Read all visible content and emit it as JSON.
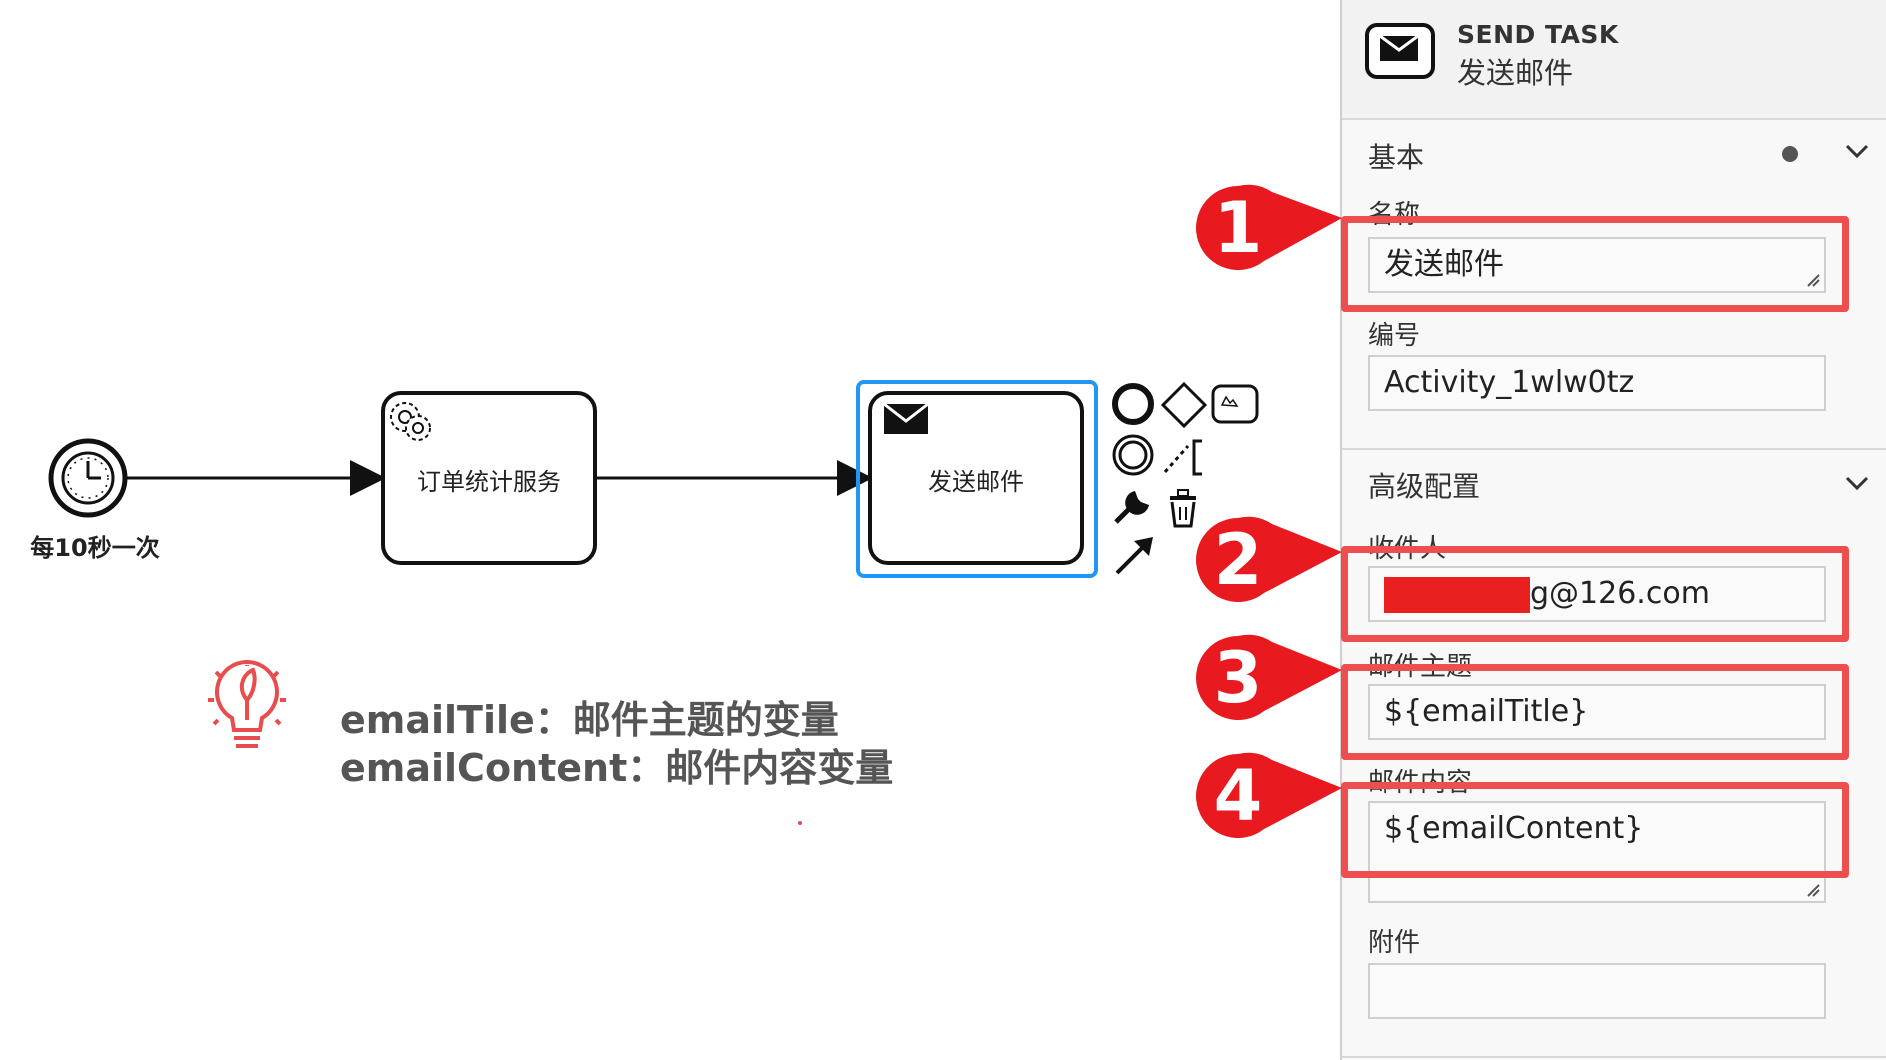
{
  "canvas": {
    "timer_event_label": "每10秒一次",
    "task1_label": "订单统计服务",
    "task2_label": "发送邮件",
    "tip_lines": [
      "emailTile：邮件主题的变量",
      "emailContent：邮件内容变量"
    ]
  },
  "panel": {
    "element_type": "SEND TASK",
    "element_name": "发送邮件",
    "groups": {
      "basic": {
        "title": "基本",
        "name_label": "名称",
        "name_value": "发送邮件",
        "id_label": "编号",
        "id_value": "Activity_1wlw0tz"
      },
      "advanced": {
        "title": "高级配置",
        "recipient_label": "收件人",
        "recipient_value": "g@126.com",
        "subject_label": "邮件主题",
        "subject_value": "${emailTitle}",
        "content_label": "邮件内容",
        "content_value": "${emailContent}",
        "attachment_label": "附件",
        "attachment_value": ""
      }
    }
  },
  "annotations": {
    "callouts": [
      "1",
      "2",
      "3",
      "4"
    ]
  },
  "colors": {
    "accent_red": "#ef4e4e",
    "selection_blue": "#2196f3",
    "callout_red": "#e8191f"
  },
  "icons": [
    "timer-icon",
    "service-gear-icon",
    "envelope-icon",
    "lightbulb-icon",
    "wrench-icon",
    "trash-icon",
    "arrow-icon",
    "chevron-down-icon"
  ]
}
